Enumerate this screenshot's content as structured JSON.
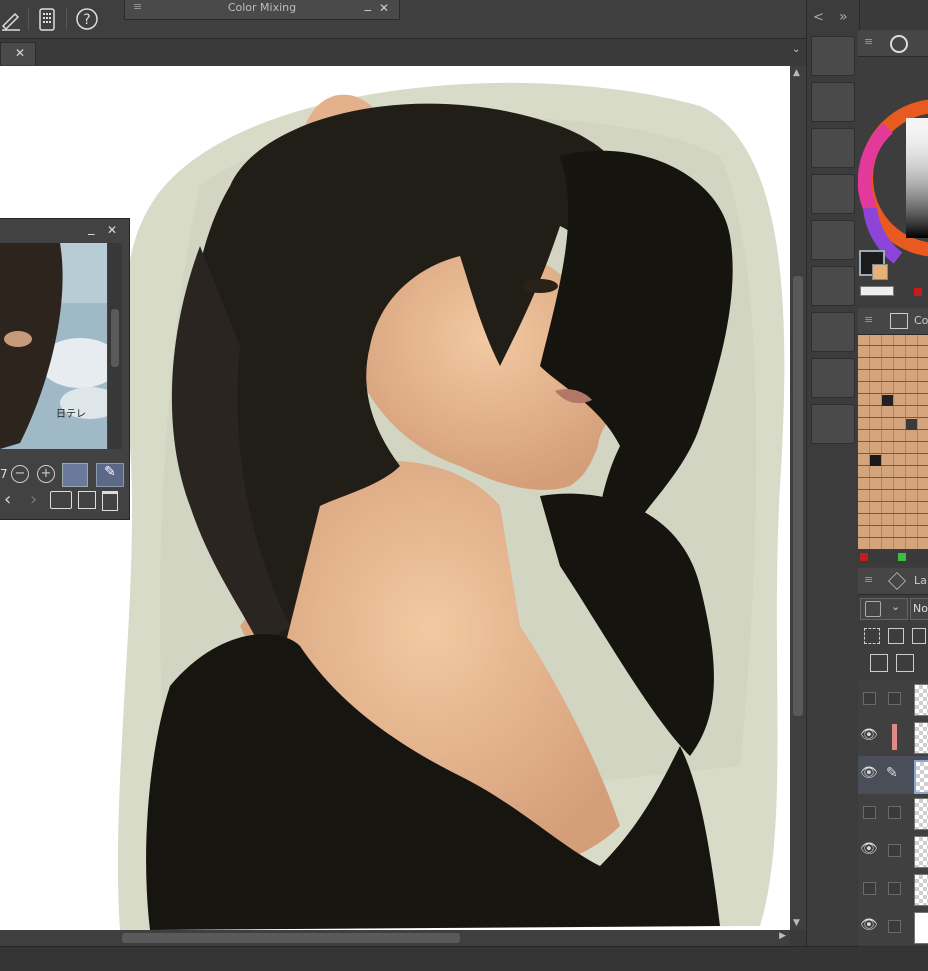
{
  "toolbar": {
    "icons": [
      "pen-settings-icon",
      "smartphone-icon",
      "help-icon"
    ]
  },
  "color_mixing": {
    "title": "Color Mixing"
  },
  "document_tab": {
    "close_glyph": "✕"
  },
  "navigator": {
    "zoom_value": "7",
    "thumbnail_caption": "日テレ"
  },
  "right_panel": {
    "collapse_glyph": "<",
    "expand_glyph": "»",
    "color_set_tab": "Co",
    "layer_tab": "La",
    "blend_mode": "No"
  },
  "layers": [
    {
      "visible": false
    },
    {
      "visible": true,
      "color_marker": true
    },
    {
      "visible": true,
      "editing": true
    },
    {
      "visible": false
    },
    {
      "visible": true
    },
    {
      "visible": false
    },
    {
      "visible": true,
      "paper": true
    }
  ],
  "colors": {
    "main": "#1b1b1b",
    "sub": "#e8b07a",
    "background": "#ffffff"
  }
}
